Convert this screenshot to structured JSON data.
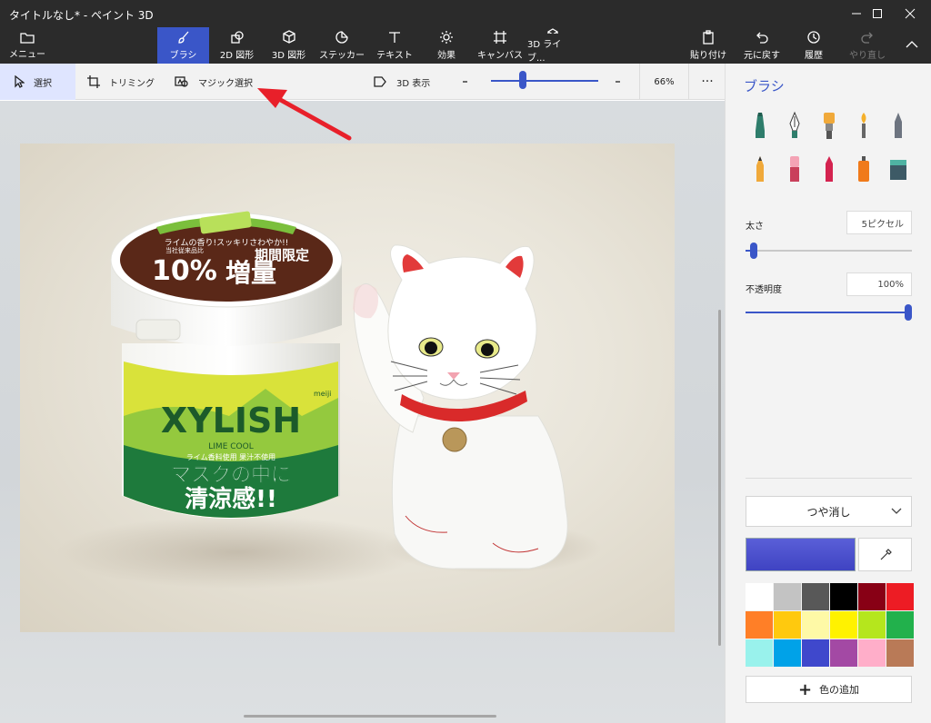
{
  "window": {
    "title": "タイトルなし* - ペイント 3D"
  },
  "ribbon": {
    "menu": "メニュー",
    "tabs": [
      "ブラシ",
      "2D 図形",
      "3D 図形",
      "ステッカー",
      "テキスト",
      "効果",
      "キャンバス",
      "3D ライブ..."
    ],
    "active_tab": "ブラシ",
    "right": [
      "貼り付け",
      "元に戻す",
      "履歴",
      "やり直し"
    ]
  },
  "subtoolbar": {
    "select": "選択",
    "trim": "トリミング",
    "magic_select": "マジック選択",
    "view3d": "3D 表示",
    "zoom_percent": "66%",
    "zoom_slider_level": 0.3,
    "more": "···"
  },
  "photo": {
    "jar_lid_top": "ライムの香り!スッキリさわやか!!",
    "jar_lid_small": "当社従来品比",
    "jar_lid_big_number": "10%",
    "jar_lid_big_word": "増量",
    "jar_lid_promo": "期間限定",
    "jar_brand": "XYLISH",
    "jar_brand_sub": "LIME COOL",
    "jar_note": "ライム香料使用 果汁不使用",
    "jar_mask_1": "マスクの中に",
    "jar_mask_2": "清涼感!!",
    "jar_maker": "meiji"
  },
  "panel": {
    "title": "ブラシ",
    "thickness_label": "太さ",
    "thickness_value": "5ピクセル",
    "thickness_level": 0.05,
    "opacity_label": "不透明度",
    "opacity_value": "100%",
    "opacity_level": 1.0,
    "finish": "つや消し",
    "current_color": "#3f43c2",
    "add_color": "色の追加",
    "palette": [
      "#ffffff",
      "#c3c3c3",
      "#585858",
      "#000000",
      "#880015",
      "#ed1c24",
      "#ff7f27",
      "#ffc90e",
      "#fef9a6",
      "#fff200",
      "#b5e61d",
      "#22b14c",
      "#99f2ec",
      "#00a2e8",
      "#3f48cc",
      "#a349a4",
      "#ffaec9",
      "#b97a57"
    ],
    "brushes": [
      "marker-icon",
      "calligraphy-pen-icon",
      "oil-brush-icon",
      "watercolor-icon",
      "pixel-pen-icon",
      "pencil-icon",
      "eraser-icon",
      "crayon-icon",
      "spray-can-icon",
      "fill-bucket-icon"
    ]
  },
  "accent": "#3a56c8",
  "annotation_arrow_color": "#e8202a"
}
